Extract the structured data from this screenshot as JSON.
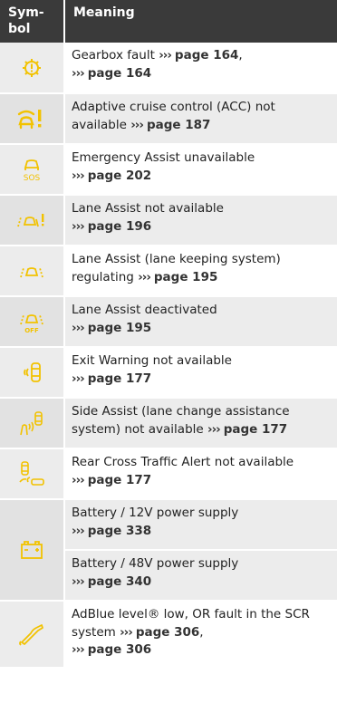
{
  "header": {
    "symbol": "Sym-\nbol",
    "meaning": "Meaning"
  },
  "colors": {
    "icon": "#f2c200",
    "header_bg": "#3a3a3a",
    "row_alt": "#ececec"
  },
  "rows": [
    {
      "icon": "gearbox-fault-icon",
      "text": "Gearbox fault",
      "ref1": "page 164",
      "sep": ",",
      "ref2": "page 164"
    },
    {
      "icon": "acc-unavailable-icon",
      "text": "Adaptive cruise control (ACC) not available",
      "ref1": "page 187"
    },
    {
      "icon": "emergency-assist-sos-icon",
      "icon_label": "SOS",
      "text": "Emergency Assist unavailable",
      "ref1": "page 202"
    },
    {
      "icon": "lane-assist-unavailable-icon",
      "text": "Lane Assist not available",
      "ref1": "page 196"
    },
    {
      "icon": "lane-assist-regulating-icon",
      "text": "Lane Assist (lane keeping system) regulating",
      "ref1": "page 195"
    },
    {
      "icon": "lane-assist-off-icon",
      "icon_label": "OFF",
      "text": "Lane Assist deactivated",
      "ref1": "page 195"
    },
    {
      "icon": "exit-warning-icon",
      "text": "Exit Warning not available",
      "ref1": "page 177"
    },
    {
      "icon": "side-assist-icon",
      "text": "Side Assist (lane change assistance system) not available",
      "ref1": "page 177"
    },
    {
      "icon": "rear-cross-traffic-icon",
      "text": "Rear Cross Traffic Alert not available",
      "ref1": "page 177"
    },
    {
      "icon": "battery-icon",
      "text": "Battery / 12V power supply",
      "ref1": "page 338",
      "text2": "Battery / 48V power supply",
      "ref2": "page 340"
    },
    {
      "icon": "adblue-icon",
      "text": "AdBlue level® low, OR fault in the SCR system",
      "ref1": "page 306",
      "sep": ",",
      "ref2": "page 306"
    }
  ],
  "arrow": "›››"
}
